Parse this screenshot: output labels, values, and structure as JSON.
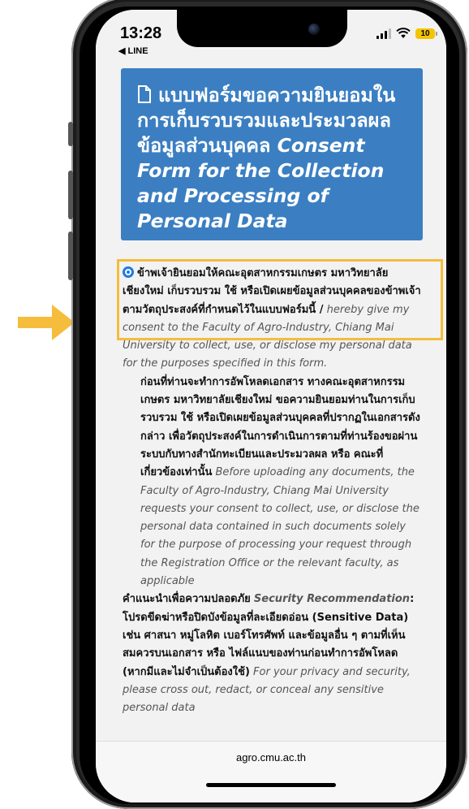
{
  "status_bar": {
    "time": "13:28",
    "back_app": "◀ LINE",
    "battery": "10"
  },
  "hero": {
    "title_th": "แบบฟอร์มขอความยินยอมในการเก็บรวบรวมและประมวลผลข้อมูลส่วนบุคคล",
    "title_en": "Consent Form for the Collection and Processing of Personal Data"
  },
  "consent": {
    "checkbox_text_th": "ข้าพเจ้ายินยอมให้คณะอุตสาหกรรมเกษตร มหาวิทยาลัยเชียงใหม่ เก็บรวบรวม ใช้ หรือเปิดเผยข้อมูลส่วนบุคคลของข้าพเจ้า ตามวัตถุประสงค์ที่กำหนดไว้ในแบบฟอร์มนี้ /",
    "checkbox_text_en": "hereby give my consent to the Faculty of Agro-Industry, Chiang Mai University to collect, use, or disclose my personal data for the purposes specified in this form."
  },
  "notice": {
    "text_th": "ก่อนที่ท่านจะทำการอัพโหลดเอกสาร ทางคณะอุตสาหกรรมเกษตร มหาวิทยาลัยเชียงใหม่ ขอความยินยอมท่านในการเก็บรวบรวม ใช้ หรือเปิดเผยข้อมูลส่วนบุคคลที่ปรากฏในเอกสารดังกล่าว เพื่อวัตถุประสงค์ในการดำเนินการตามที่ท่านร้องขอผ่านระบบกับทางสำนักทะเบียนและประมวลผล หรือ คณะที่เกี่ยวข้องเท่านั้น",
    "text_en": "Before uploading any documents, the Faculty of Agro-Industry, Chiang Mai University requests your consent to collect, use, or disclose the personal data contained in such documents solely for the purpose of processing your request through the Registration Office or the relevant faculty, as applicable"
  },
  "security": {
    "heading_th": "คำแนะนำเพื่อความปลอดภัย",
    "heading_en": "Security Recommendation",
    "text_th": ": โปรดขีดฆ่าหรือปิดบังข้อมูลที่ละเอียดอ่อน (Sensitive Data) เช่น ศาสนา หมู่โลหิต เบอร์โทรศัพท์ และข้อมูลอื่น ๆ ตามที่เห็นสมควรบนเอกสาร หรือ ไฟล์แนบของท่านก่อนทำการอัพโหลด (หากมีและไม่จำเป็นต้องใช้)",
    "text_en": "For your privacy and security, please cross out, redact, or conceal any sensitive personal data"
  },
  "browser": {
    "url": "agro.cmu.ac.th"
  },
  "colors": {
    "hero_bg": "#3b7fc2",
    "highlight": "#f5bd3b",
    "radio": "#1f7ae0"
  }
}
